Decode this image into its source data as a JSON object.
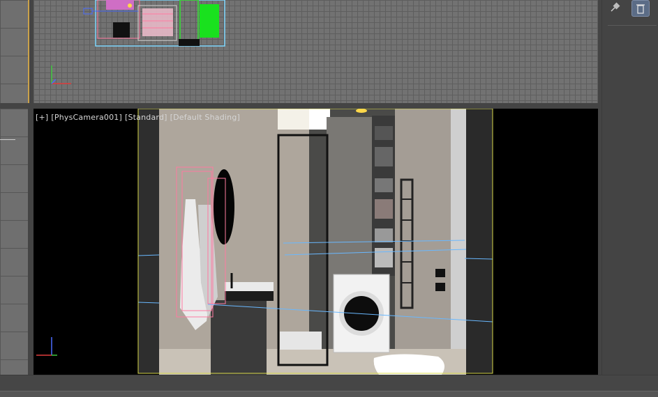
{
  "viewport_top": {
    "name": "top-viewport"
  },
  "viewport_camera": {
    "labels": {
      "plus": "[+]",
      "camera": "[PhysCamera001]",
      "shading": "[Standard]",
      "mode": "[Default Shading]"
    }
  },
  "command_panel": {
    "tools": [
      {
        "icon": "pin-icon"
      },
      {
        "icon": "trash-icon"
      }
    ]
  },
  "colors": {
    "ui_background": "#444444",
    "viewport_grid": "#727272",
    "safe_frame": "#d8d84a",
    "selection_pink": "#ff7aa0",
    "axis_x": "#e03c3c",
    "axis_y": "#3fc83f",
    "axis_z": "#4a6cff"
  }
}
